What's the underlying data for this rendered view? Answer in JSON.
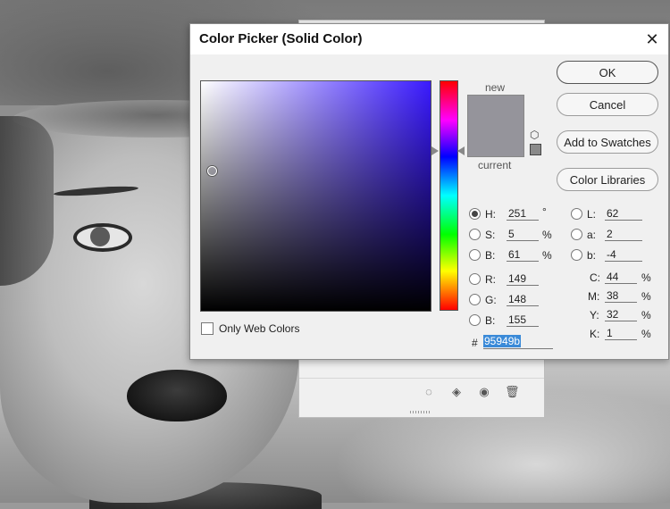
{
  "dialog": {
    "title": "Color Picker (Solid Color)",
    "buttons": {
      "ok": "OK",
      "cancel": "Cancel",
      "add_to_swatches": "Add to Swatches",
      "color_libraries": "Color Libraries"
    },
    "preview": {
      "new_label": "new",
      "current_label": "current",
      "new_color": "#95949b",
      "current_color": "#95949b"
    },
    "only_web_colors": {
      "label": "Only Web Colors",
      "checked": false
    },
    "hsb": {
      "h": {
        "label": "H:",
        "value": "251",
        "unit": "°",
        "selected": true
      },
      "s": {
        "label": "S:",
        "value": "5",
        "unit": "%"
      },
      "b": {
        "label": "B:",
        "value": "61",
        "unit": "%"
      }
    },
    "rgb": {
      "r": {
        "label": "R:",
        "value": "149"
      },
      "g": {
        "label": "G:",
        "value": "148"
      },
      "b": {
        "label": "B:",
        "value": "155"
      }
    },
    "lab": {
      "l": {
        "label": "L:",
        "value": "62"
      },
      "a": {
        "label": "a:",
        "value": "2"
      },
      "b": {
        "label": "b:",
        "value": "-4"
      }
    },
    "cmyk": {
      "c": {
        "label": "C:",
        "value": "44",
        "unit": "%"
      },
      "m": {
        "label": "M:",
        "value": "38",
        "unit": "%"
      },
      "y": {
        "label": "Y:",
        "value": "32",
        "unit": "%"
      },
      "k": {
        "label": "K:",
        "value": "1",
        "unit": "%"
      }
    },
    "hex": {
      "label": "#",
      "value": "95949b"
    },
    "hue_color": "#3a1aff"
  },
  "layers_panel": {
    "toolbar_icons": [
      "selection-icon",
      "adjustment-icon",
      "eye-icon",
      "trash-icon"
    ]
  },
  "colors": {
    "accent_selection": "#3a8ad8"
  }
}
